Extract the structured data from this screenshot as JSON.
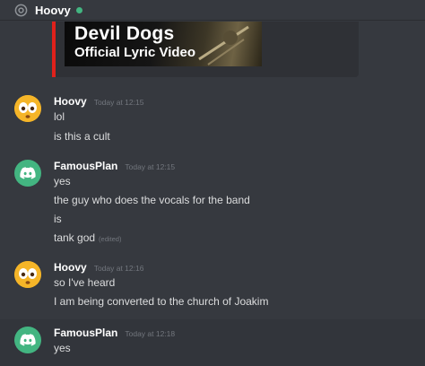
{
  "header": {
    "channel_name": "Hoovy",
    "icon": "at-icon",
    "status_color": "#43b581"
  },
  "embed": {
    "accent_color": "#e0211b",
    "thumbnail_line1": "Devil Dogs",
    "thumbnail_line2": "Official Lyric Video"
  },
  "messages": [
    {
      "author": "Hoovy",
      "avatar": "face-emoji-avatar",
      "timestamp": "Today at 12:15",
      "lines": [
        {
          "text": "lol"
        },
        {
          "text": "is this a cult"
        }
      ]
    },
    {
      "author": "FamousPlan",
      "avatar": "discord-logo-avatar",
      "timestamp": "Today at 12:15",
      "lines": [
        {
          "text": "yes"
        },
        {
          "text": "the guy who does the vocals for the band"
        },
        {
          "text": "is"
        },
        {
          "text": "tank god",
          "edited": "(edited)"
        }
      ]
    },
    {
      "author": "Hoovy",
      "avatar": "face-emoji-avatar",
      "timestamp": "Today at 12:16",
      "lines": [
        {
          "text": "so I've heard"
        },
        {
          "text": "I am being converted to the church of Joakim"
        }
      ]
    },
    {
      "author": "FamousPlan",
      "avatar": "discord-logo-avatar",
      "timestamp": "Today at 12:18",
      "lines": [
        {
          "text": "yes"
        }
      ]
    }
  ]
}
